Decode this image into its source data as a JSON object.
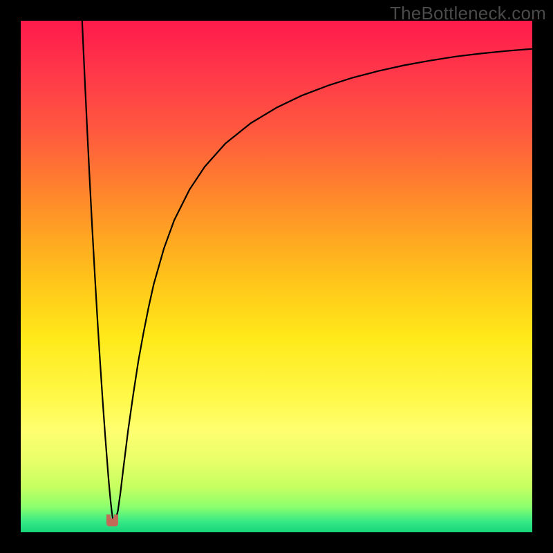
{
  "watermark": {
    "text": "TheBottleneck.com"
  },
  "chart_data": {
    "type": "line",
    "title": "",
    "xlabel": "",
    "ylabel": "",
    "xlim": [
      0,
      100
    ],
    "ylim": [
      0,
      100
    ],
    "gradient_stops": [
      {
        "offset": 0.0,
        "color": "#ff1a4b"
      },
      {
        "offset": 0.1,
        "color": "#ff374a"
      },
      {
        "offset": 0.22,
        "color": "#ff5a3e"
      },
      {
        "offset": 0.35,
        "color": "#ff8a2a"
      },
      {
        "offset": 0.5,
        "color": "#ffc21a"
      },
      {
        "offset": 0.62,
        "color": "#ffe91a"
      },
      {
        "offset": 0.74,
        "color": "#fff94a"
      },
      {
        "offset": 0.8,
        "color": "#ffff70"
      },
      {
        "offset": 0.86,
        "color": "#e8ff6a"
      },
      {
        "offset": 0.91,
        "color": "#c7ff60"
      },
      {
        "offset": 0.95,
        "color": "#8dff6e"
      },
      {
        "offset": 0.98,
        "color": "#34e886"
      },
      {
        "offset": 1.0,
        "color": "#18d47a"
      }
    ],
    "series": [
      {
        "name": "curve",
        "x": [
          12.0,
          12.5,
          13.0,
          13.5,
          14.0,
          14.5,
          15.0,
          15.5,
          16.0,
          16.5,
          17.0,
          17.2,
          17.4,
          17.6,
          17.8,
          18.0,
          18.2,
          18.5,
          19.0,
          19.5,
          20.0,
          21.0,
          22.0,
          23.0,
          24.0,
          25.0,
          26.0,
          28.0,
          30.0,
          33.0,
          36.0,
          40.0,
          45.0,
          50.0,
          55.0,
          60.0,
          65.0,
          70.0,
          75.0,
          80.0,
          85.0,
          90.0,
          95.0,
          100.0
        ],
        "y": [
          100.0,
          89.0,
          78.5,
          68.5,
          59.0,
          50.0,
          41.5,
          33.5,
          26.0,
          19.0,
          12.5,
          10.0,
          7.8,
          5.8,
          4.0,
          2.6,
          2.0,
          2.2,
          4.2,
          7.8,
          12.0,
          20.0,
          27.0,
          33.5,
          39.0,
          44.0,
          48.5,
          55.5,
          61.0,
          67.0,
          71.5,
          76.0,
          80.0,
          83.0,
          85.4,
          87.3,
          88.9,
          90.2,
          91.3,
          92.2,
          93.0,
          93.6,
          94.1,
          94.5
        ]
      }
    ],
    "marker": {
      "shape": "u-notch",
      "fill": "#c16a57",
      "stroke": "#c16a57",
      "cx_data": 17.9,
      "cy_data": 2.2
    }
  }
}
